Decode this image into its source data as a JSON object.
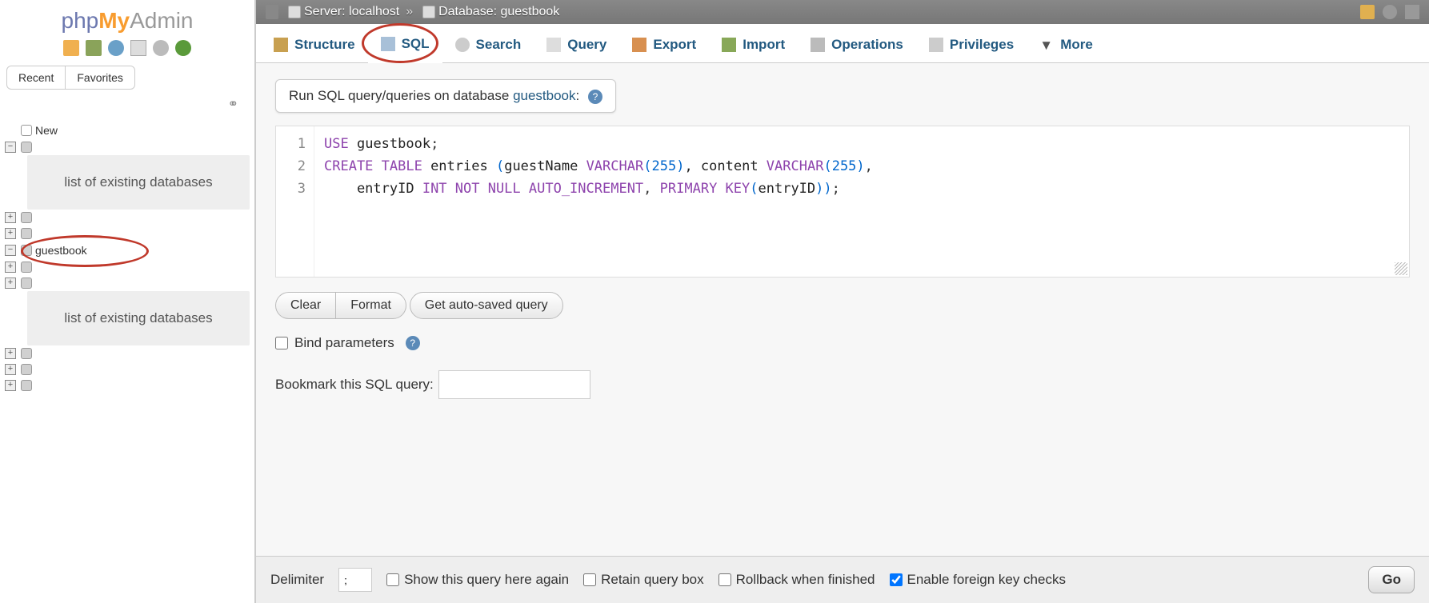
{
  "logo": {
    "php": "php",
    "my": "My",
    "admin": "Admin"
  },
  "sidebar": {
    "tabs": {
      "recent": "Recent",
      "favorites": "Favorites"
    },
    "new": "New",
    "placeholder": "list of existing databases",
    "guestbook": "guestbook"
  },
  "breadcrumb": {
    "server_label": "Server:",
    "server": "localhost",
    "db_label": "Database:",
    "db": "guestbook"
  },
  "maintabs": {
    "structure": "Structure",
    "sql": "SQL",
    "search": "Search",
    "query": "Query",
    "export": "Export",
    "import": "Import",
    "operations": "Operations",
    "privileges": "Privileges",
    "more": "More"
  },
  "panel": {
    "prefix": "Run SQL query/queries on database ",
    "db": "guestbook",
    "suffix": ":"
  },
  "code": {
    "lines": [
      "1",
      "2",
      "3"
    ],
    "l1": "USE guestbook;",
    "l2_a": "CREATE TABLE",
    "l2_b": " entries ",
    "l2_c": "(",
    "l2_d": "guestName ",
    "l2_e": "VARCHAR",
    "l2_f": "(",
    "l2_g": "255",
    "l2_h": ")",
    "l2_i": ", content ",
    "l2_j": "VARCHAR",
    "l2_k": "(",
    "l2_l": "255",
    "l2_m": ")",
    "l2_n": ",",
    "l3_a": "    entryID ",
    "l3_b": "INT NOT NULL AUTO_INCREMENT",
    "l3_c": ", ",
    "l3_d": "PRIMARY KEY",
    "l3_e": "(",
    "l3_f": "entryID",
    "l3_g": ")",
    "l3_h": ")",
    "l3_i": ";"
  },
  "buttons": {
    "clear": "Clear",
    "format": "Format",
    "autosaved": "Get auto-saved query"
  },
  "bind_params": "Bind parameters",
  "bookmark_label": "Bookmark this SQL query:",
  "footer": {
    "delimiter_label": "Delimiter",
    "delimiter_val": ";",
    "show_again": "Show this query here again",
    "retain": "Retain query box",
    "rollback": "Rollback when finished",
    "fk": "Enable foreign key checks",
    "go": "Go"
  }
}
